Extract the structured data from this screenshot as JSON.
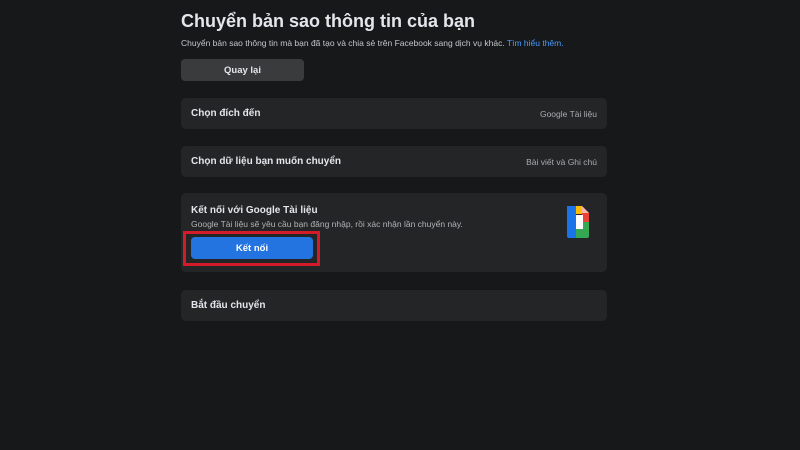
{
  "header": {
    "title": "Chuyển bản sao thông tin của bạn",
    "subtitle": "Chuyển bản sao thông tin mà bạn đã tạo và chia sẻ trên Facebook sang dịch vụ khác.",
    "learn_more": "Tìm hiểu thêm."
  },
  "back_button": {
    "label": "Quay lại"
  },
  "destination": {
    "label": "Chọn đích đến",
    "value": "Google Tài liệu"
  },
  "data_choice": {
    "label": "Chọn dữ liệu bạn muốn chuyển",
    "value": "Bài viết và Ghi chú"
  },
  "connect": {
    "title": "Kết nối với Google Tài liệu",
    "description": "Google Tài liệu sẽ yêu cầu bạn đăng nhập, rồi xác nhận lần chuyển này.",
    "button_label": "Kết nối",
    "icon": "google-docs-icon",
    "highlight_color": "#d31b2a",
    "button_color": "#2374e1"
  },
  "start_transfer": {
    "label": "Bắt đầu chuyển"
  }
}
